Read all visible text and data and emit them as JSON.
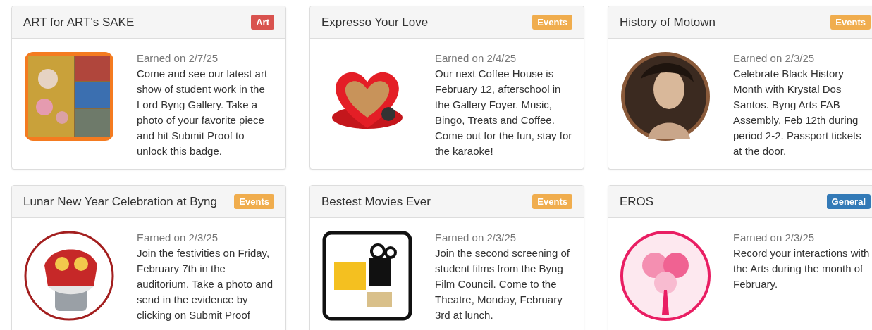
{
  "badges": [
    {
      "title": "ART for ART's SAKE",
      "category": "Art",
      "color": "#d9534f",
      "earned": "Earned on 2/7/25",
      "description": "Come and see our latest art show of student work in the Lord Byng Gallery. Take a photo of your favorite piece and hit Submit Proof to unlock this badge."
    },
    {
      "title": "Expresso Your Love",
      "category": "Events",
      "color": "#f0ad4e",
      "earned": "Earned on 2/4/25",
      "description": "Our next Coffee House is February 12, afterschool in the Gallery Foyer. Music, Bingo, Treats and Coffee. Come out for the fun, stay for the karaoke!"
    },
    {
      "title": "History of Motown",
      "category": "Events",
      "color": "#f0ad4e",
      "earned": "Earned on 2/3/25",
      "description": "Celebrate Black History Month with Krystal Dos Santos. Byng Arts FAB Assembly, Feb 12th during period 2-2. Passport tickets at the door."
    },
    {
      "title": "Lunar New Year Celebration at Byng",
      "category": "Events",
      "color": "#f0ad4e",
      "earned": "Earned on 2/3/25",
      "description": "Join the festivities on Friday, February 7th in the auditorium. Take a photo and send in the evidence by clicking on Submit Proof"
    },
    {
      "title": "Bestest Movies Ever",
      "category": "Events",
      "color": "#f0ad4e",
      "earned": "Earned on 2/3/25",
      "description": "Join the second screening of student films from the Byng Film Council. Come to the Theatre, Monday, February 3rd at lunch."
    },
    {
      "title": "EROS",
      "category": "General",
      "color": "#337ab7",
      "earned": "Earned on 2/3/25",
      "description": "Record your interactions with the Arts during the month of February."
    }
  ]
}
